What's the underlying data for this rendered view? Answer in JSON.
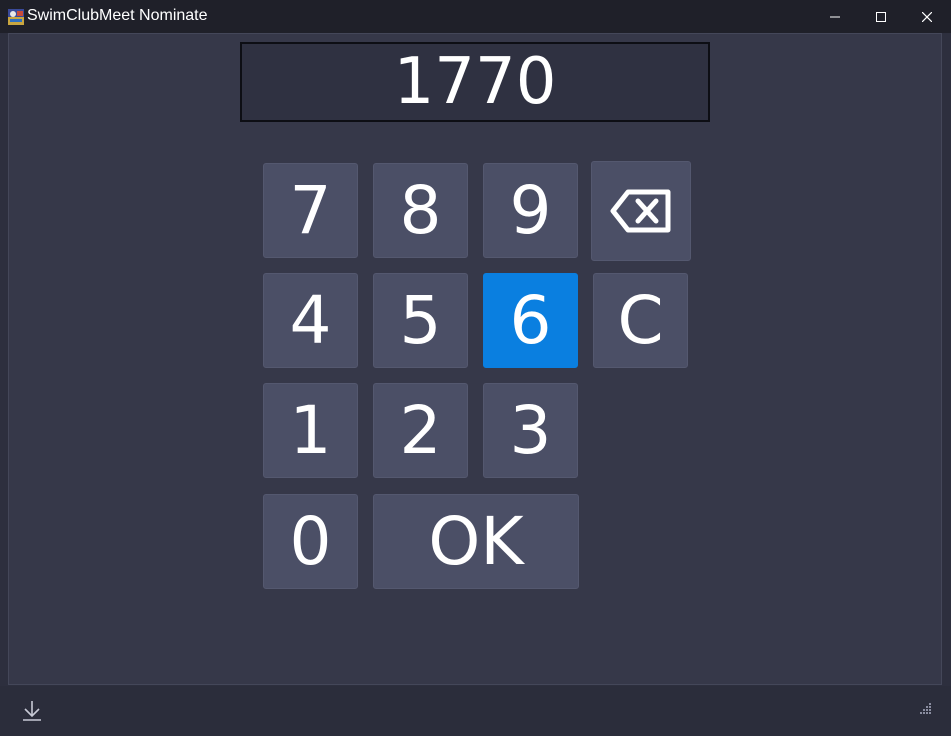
{
  "window": {
    "title": "SwimClubMeet Nominate",
    "controls": {
      "minimize_icon": "minimize-icon",
      "maximize_icon": "maximize-icon",
      "close_icon": "close-icon"
    }
  },
  "display": {
    "value": "1770"
  },
  "keypad": {
    "keys": {
      "k7": "7",
      "k8": "8",
      "k9": "9",
      "k4": "4",
      "k5": "5",
      "k6": "6",
      "clear": "C",
      "k1": "1",
      "k2": "2",
      "k3": "3",
      "k0": "0",
      "ok": "OK"
    },
    "backspace_icon": "backspace-icon",
    "active_key": "6"
  },
  "colors": {
    "accent": "#0a7fe0",
    "key_background": "#4b4f66",
    "client_background": "#363849",
    "titlebar_background": "#1f2029"
  },
  "footer": {
    "download_icon": "download-icon",
    "resize_grip_icon": "resize-grip-icon"
  }
}
